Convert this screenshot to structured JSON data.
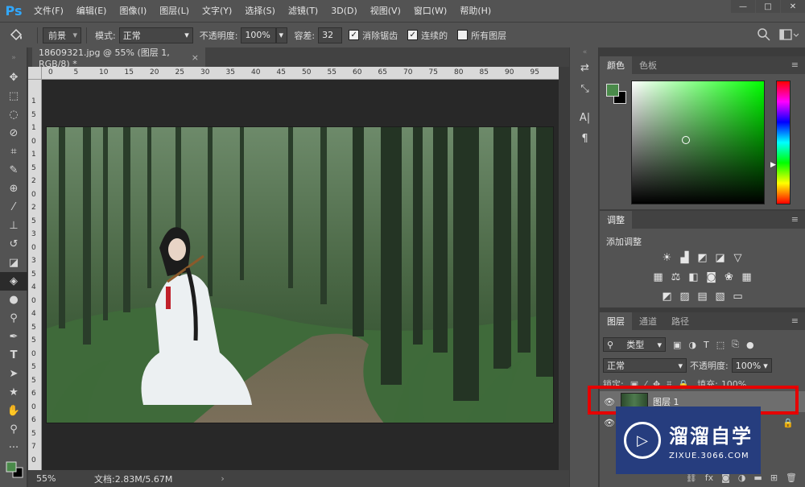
{
  "app": {
    "logo": "Ps"
  },
  "menu": [
    "文件(F)",
    "编辑(E)",
    "图像(I)",
    "图层(L)",
    "文字(Y)",
    "选择(S)",
    "滤镜(T)",
    "3D(D)",
    "视图(V)",
    "窗口(W)",
    "帮助(H)"
  ],
  "window_controls": {
    "minimize": "—",
    "maximize": "□",
    "close": "✕"
  },
  "options": {
    "fill_source": "前景",
    "mode_label": "模式:",
    "mode_value": "正常",
    "opacity_label": "不透明度:",
    "opacity_value": "100%",
    "tolerance_label": "容差:",
    "tolerance_value": "32",
    "antialias_label": "消除锯齿",
    "antialias_checked": true,
    "contiguous_label": "连续的",
    "contiguous_checked": true,
    "all_layers_label": "所有图层",
    "all_layers_checked": false
  },
  "document": {
    "tab_title": "18609321.jpg @ 55% (图层 1, RGB/8) *",
    "tab_close": "×",
    "ruler_h": [
      "0",
      "5",
      "10",
      "15",
      "20",
      "25",
      "30",
      "35",
      "40",
      "45",
      "50",
      "55",
      "60",
      "65",
      "70",
      "75",
      "80",
      "85",
      "90",
      "95"
    ],
    "ruler_v": [
      "1",
      "5",
      "1",
      "0",
      "1",
      "5",
      "2",
      "0",
      "2",
      "5",
      "3",
      "0",
      "3",
      "5",
      "4",
      "0",
      "4",
      "5",
      "5",
      "0",
      "5",
      "5",
      "6",
      "0",
      "6",
      "5",
      "7",
      "0"
    ]
  },
  "status": {
    "zoom": "55%",
    "doc_size": "文档:2.83M/5.67M",
    "arrow": "›"
  },
  "panels": {
    "color_tabs": [
      "颜色",
      "色板"
    ],
    "adjust_tab": "调整",
    "adjust_title": "添加调整",
    "layer_tabs": [
      "图层",
      "通道",
      "路径"
    ],
    "layer_filter": "类型",
    "blend_mode": "正常",
    "layer_opacity_label": "不透明度:",
    "layer_opacity_value": "100%",
    "lock_label": "锁定:",
    "fill_label": "填充:",
    "fill_value": "100%",
    "layers": [
      {
        "name": "图层 1",
        "selected": true
      },
      {
        "name": "",
        "selected": false
      }
    ]
  },
  "colors": {
    "foreground": "#4a8a4a",
    "background": "#000000",
    "highlight": "#e50000"
  },
  "watermark": {
    "cn": "溜溜自学",
    "en": "ZIXUE.3066.COM"
  }
}
